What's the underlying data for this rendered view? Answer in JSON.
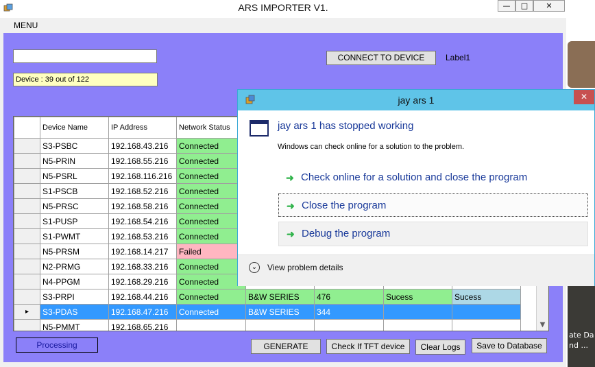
{
  "window": {
    "title": "ARS IMPORTER V1.",
    "minimize_glyph": "—",
    "maximize_glyph": "□",
    "close_glyph": "✕"
  },
  "menu": {
    "label": "MENU"
  },
  "top": {
    "input_value": "",
    "device_label": "Device :  39  out of  122",
    "connect_button": "CONNECT TO DEVICE",
    "label1": "Label1"
  },
  "grid": {
    "columns": [
      "Device Name",
      "IP Address",
      "Network Status",
      "",
      "",
      "",
      ""
    ],
    "rows": [
      {
        "name": "S3-PSBC",
        "ip": "192.168.43.216",
        "status": "Connected",
        "series": "",
        "count": "",
        "r1": "",
        "r2": ""
      },
      {
        "name": "N5-PRIN",
        "ip": "192.168.55.216",
        "status": "Connected",
        "series": "",
        "count": "",
        "r1": "",
        "r2": ""
      },
      {
        "name": "N5-PSRL",
        "ip": "192.168.116.216",
        "status": "Connected",
        "series": "",
        "count": "",
        "r1": "",
        "r2": ""
      },
      {
        "name": "S1-PSCB",
        "ip": "192.168.52.216",
        "status": "Connected",
        "series": "",
        "count": "",
        "r1": "",
        "r2": ""
      },
      {
        "name": "N5-PRSC",
        "ip": "192.168.58.216",
        "status": "Connected",
        "series": "",
        "count": "",
        "r1": "",
        "r2": ""
      },
      {
        "name": "S1-PUSP",
        "ip": "192.168.54.216",
        "status": "Connected",
        "series": "",
        "count": "",
        "r1": "",
        "r2": ""
      },
      {
        "name": "S1-PWMT",
        "ip": "192.168.53.216",
        "status": "Connected",
        "series": "",
        "count": "",
        "r1": "",
        "r2": ""
      },
      {
        "name": "N5-PRSM",
        "ip": "192.168.14.217",
        "status": "Failed",
        "series": "",
        "count": "",
        "r1": "",
        "r2": ""
      },
      {
        "name": "N2-PRMG",
        "ip": "192.168.33.216",
        "status": "Connected",
        "series": "",
        "count": "",
        "r1": "",
        "r2": ""
      },
      {
        "name": "N4-PPGM",
        "ip": "192.168.29.216",
        "status": "Connected",
        "series": "",
        "count": "",
        "r1": "",
        "r2": ""
      },
      {
        "name": "S3-PRPI",
        "ip": "192.168.44.216",
        "status": "Connected",
        "series": "B&W SERIES",
        "count": "476",
        "r1": "Sucess",
        "r2": "Sucess"
      },
      {
        "name": "S3-PDAS",
        "ip": "192.168.47.216",
        "status": "Connected",
        "series": "B&W SERIES",
        "count": "344",
        "r1": "",
        "r2": ""
      },
      {
        "name": "N5-PMMT",
        "ip": "192.168.65.216",
        "status": "",
        "series": "",
        "count": "",
        "r1": "",
        "r2": ""
      }
    ],
    "selected_row_marker": "▸"
  },
  "bottom": {
    "processing": "Processing",
    "generate": "GENERATE",
    "check_tft": "Check If TFT device",
    "clear_logs": "Clear Logs",
    "save_db": "Save to Database"
  },
  "dialog": {
    "title": "jay ars 1",
    "heading": "jay ars 1 has stopped working",
    "subtext": "Windows can check online for a solution to the problem.",
    "options": [
      "Check online for a solution and close the program",
      "Close the program",
      "Debug the program"
    ],
    "details": "View problem details",
    "close_glyph": "✕"
  },
  "background_window": {
    "text_line1": "ate  Da",
    "text_line2": "nd ..."
  },
  "colors": {
    "client_bg": "#8b80f9",
    "connected": "#90ee90",
    "failed": "#ffb6c1",
    "selected": "#3399ff",
    "dialog_title": "#5fc4e8"
  }
}
